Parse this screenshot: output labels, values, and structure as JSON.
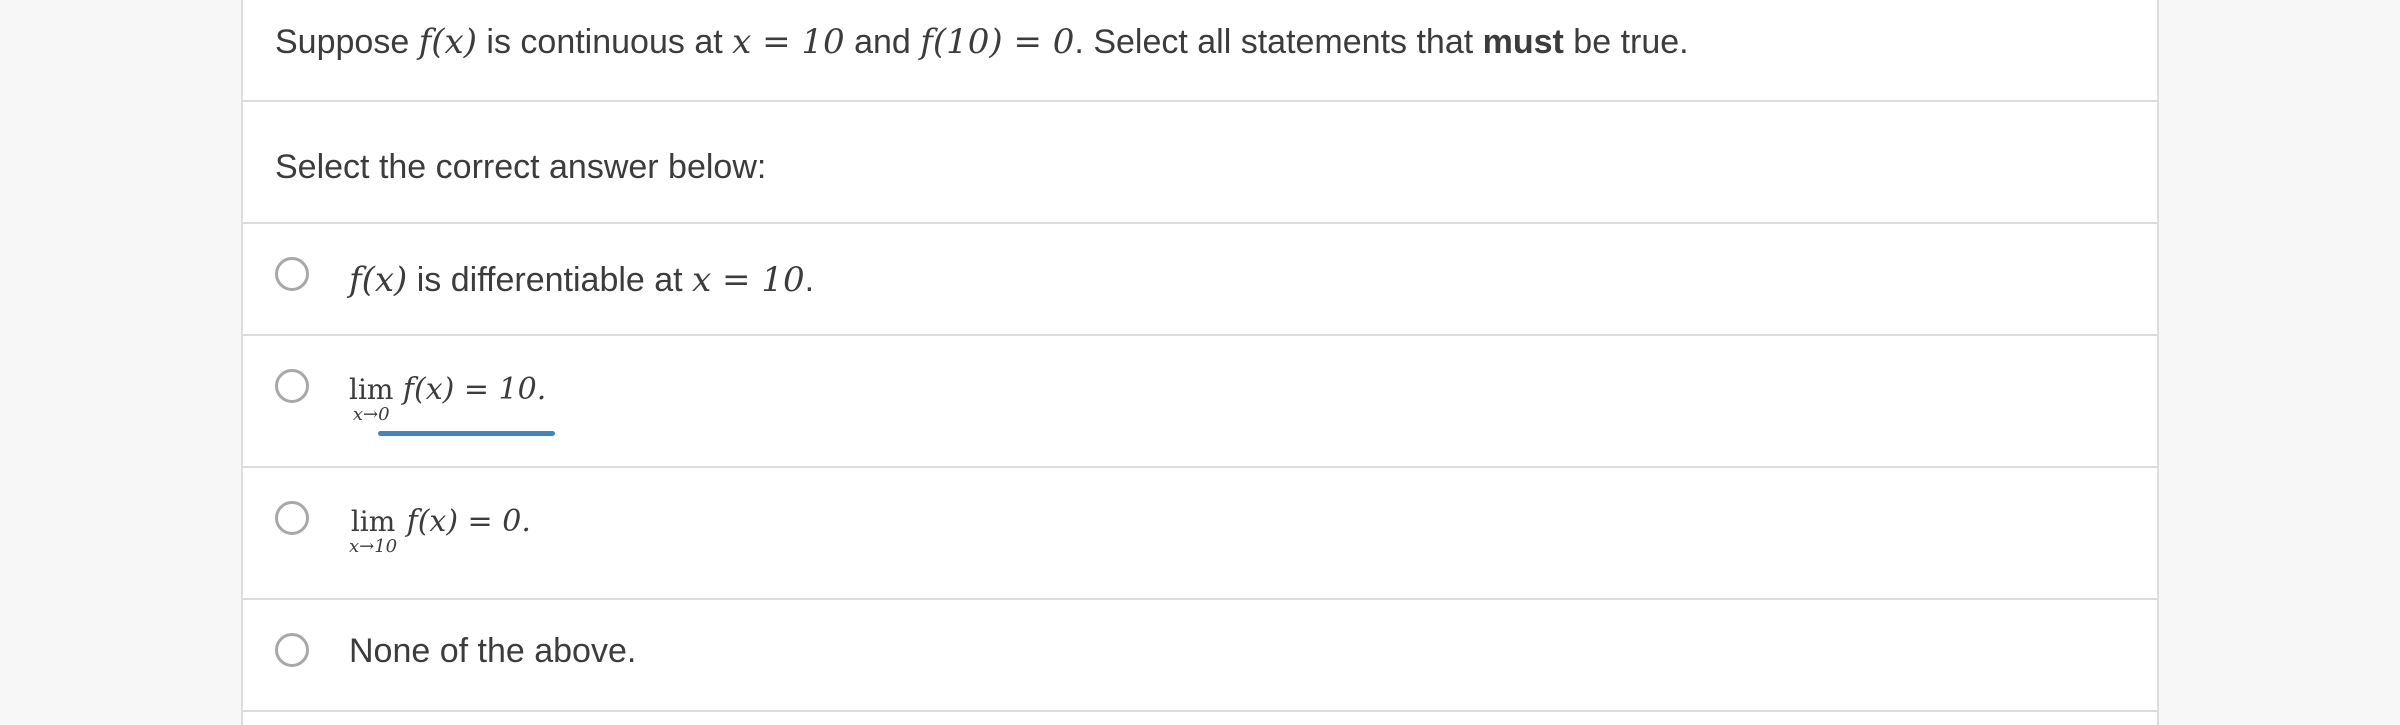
{
  "question": {
    "prefix": "Suppose ",
    "f_x": "f(x)",
    "mid1": " is continuous at ",
    "cond1": "x = 10",
    "mid2": " and ",
    "cond2": "f(10) = 0",
    "mid3": ". Select all statements that ",
    "emph": "must",
    "suffix": " be true."
  },
  "instructions": "Select the correct answer below:",
  "options": [
    {
      "math_lead": "f(x)",
      "text": " is differentiable at ",
      "math_tail": "x = 10",
      "end": "."
    },
    {
      "lim_word": "lim",
      "lim_sub": "x→0",
      "expr": "f(x) = 10."
    },
    {
      "lim_word": "lim",
      "lim_sub": "x→10",
      "expr": "f(x) = 0."
    },
    {
      "text": "None of the above."
    }
  ],
  "colors": {
    "accent": "#3d87c6",
    "border": "#dcdcdc",
    "radio": "#a8a8a8"
  }
}
